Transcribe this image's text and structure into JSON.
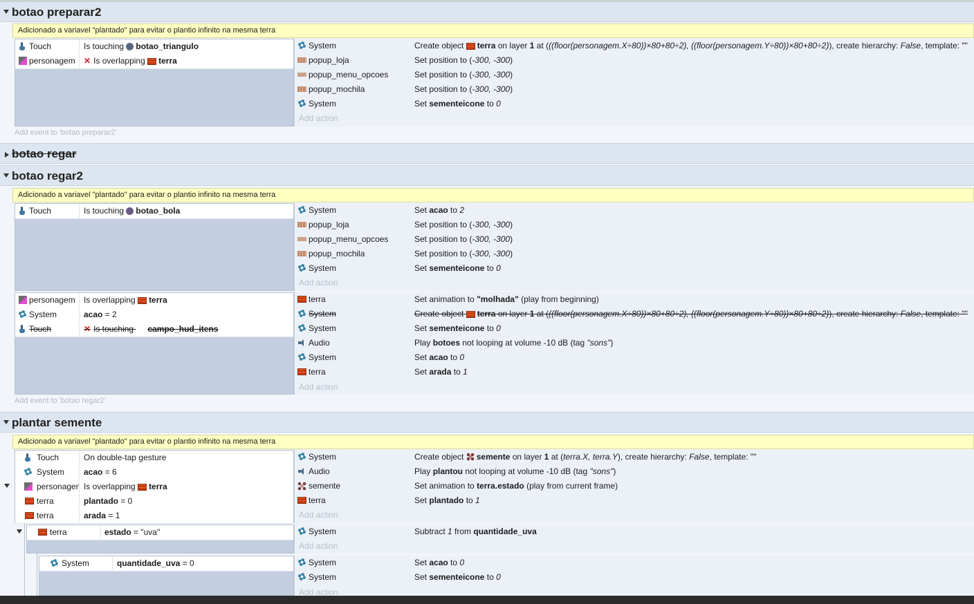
{
  "comment": "Adicionado a variavel \"plantado\" para evitar o plantio infinito na mesma terra",
  "add_action": "Add action",
  "groups": {
    "preparar2": {
      "title": "botao preparar2",
      "add_event": "Add event to 'botao preparar2'",
      "conditions": [
        {
          "obj": "Touch",
          "cond_pre": "Is touching",
          "cond_b": "botao_triangulo"
        },
        {
          "obj": "personagem",
          "cond_pre": "Is overlapping",
          "cond_b": "terra"
        }
      ],
      "actions": [
        {
          "obj": "System",
          "pre": "Create object ",
          "b1": "terra",
          "mid": " on layer ",
          "b2": "1",
          "post": " at (",
          "i1": "((floor(personagem.X÷80))×80+80÷2), ((floor(personagem.Y÷80))×80+80÷2)",
          "post2": "), create hierarchy: ",
          "i2": "False",
          "post3": ", template: \"\""
        },
        {
          "obj": "popup_loja",
          "pre": "Set position to (",
          "i1": "-300, -300",
          "post": ")"
        },
        {
          "obj": "popup_menu_opcoes",
          "pre": "Set position to (",
          "i1": "-300, -300",
          "post": ")"
        },
        {
          "obj": "popup_mochila",
          "pre": "Set position to (",
          "i1": "-300, -300",
          "post": ")"
        },
        {
          "obj": "System",
          "pre": "Set ",
          "b1": "sementeicone",
          "mid": " to ",
          "i1": "0"
        }
      ]
    },
    "regar": {
      "title": "botao regar"
    },
    "regar2": {
      "title": "botao regar2",
      "add_event": "Add event to 'botao regar2'",
      "ev1_conditions": [
        {
          "obj": "Touch",
          "cond_pre": "Is touching",
          "cond_b": "botao_bola"
        }
      ],
      "ev1_actions": [
        {
          "obj": "System",
          "pre": "Set ",
          "b1": "acao",
          "mid": " to ",
          "i1": "2"
        },
        {
          "obj": "popup_loja",
          "pre": "Set position to (",
          "i1": "-300, -300",
          "post": ")"
        },
        {
          "obj": "popup_menu_opcoes",
          "pre": "Set position to (",
          "i1": "-300, -300",
          "post": ")"
        },
        {
          "obj": "popup_mochila",
          "pre": "Set position to (",
          "i1": "-300, -300",
          "post": ")"
        },
        {
          "obj": "System",
          "pre": "Set ",
          "b1": "sementeicone",
          "mid": " to ",
          "i1": "0"
        }
      ],
      "ev2_conditions": [
        {
          "obj": "personagem",
          "cond_pre": "Is overlapping",
          "cond_b": "terra"
        },
        {
          "obj": "System",
          "cond_b": "acao",
          "cond_post": " = 2"
        },
        {
          "obj": "Touch",
          "cond_pre": "Is touching",
          "cond_b": "campo_hud_itens"
        }
      ],
      "ev2_actions": [
        {
          "obj": "terra",
          "pre": "Set animation to ",
          "b1": "\"molhada\"",
          "post": " (play from beginning)"
        },
        {
          "obj": "System",
          "pre": "Create object ",
          "b1": "terra",
          "mid": " on layer ",
          "b2": "1",
          "post": " at (",
          "i1": "((floor(personagem.X÷80))×80+80÷2), ((floor(personagem.Y÷80))×80+80÷2)",
          "post2": "), create hierarchy: ",
          "i2": "False",
          "post3": ", template: \"\""
        },
        {
          "obj": "System",
          "pre": "Set ",
          "b1": "sementeicone",
          "mid": " to ",
          "i1": "0"
        },
        {
          "obj": "Audio",
          "pre": "Play ",
          "b1": "botoes",
          "mid": " not looping at volume -10 dB (tag ",
          "i1": "\"sons\"",
          "post": ")"
        },
        {
          "obj": "System",
          "pre": "Set ",
          "b1": "acao",
          "mid": " to ",
          "i1": "0"
        },
        {
          "obj": "terra",
          "pre": "Set ",
          "b1": "arada",
          "mid": " to ",
          "i1": "1"
        }
      ]
    },
    "plantar": {
      "title": "plantar semente",
      "conditions": [
        {
          "obj": "Touch",
          "cond_pre": "On double-tap gesture"
        },
        {
          "obj": "System",
          "cond_b": "acao",
          "cond_post": " = 6"
        },
        {
          "obj": "personagem",
          "cond_pre": "Is overlapping",
          "cond_b": "terra"
        },
        {
          "obj": "terra",
          "cond_b": "plantado",
          "cond_post": " = 0"
        },
        {
          "obj": "terra",
          "cond_b": "arada",
          "cond_post": " = 1"
        }
      ],
      "actions": [
        {
          "obj": "System",
          "pre": "Create object ",
          "b1": "semente",
          "mid": " on layer ",
          "b2": "1",
          "post": " at (",
          "i1": "terra.X, terra.Y",
          "post2": "), create hierarchy: ",
          "i2": "False",
          "post3": ", template: \"\""
        },
        {
          "obj": "Audio",
          "pre": "Play ",
          "b1": "plantou",
          "mid": " not looping at volume -10 dB (tag ",
          "i1": "\"sons\"",
          "post": ")"
        },
        {
          "obj": "semente",
          "pre": "Set animation to ",
          "b1": "terra.estado",
          "post": " (play from current frame)"
        },
        {
          "obj": "terra",
          "pre": "Set ",
          "b1": "plantado",
          "mid": " to ",
          "i1": "1"
        }
      ],
      "sub1_condition": {
        "obj": "terra",
        "cond_b": "estado",
        "cond_post": " = \"uva\""
      },
      "sub1_actions": [
        {
          "obj": "System",
          "pre": "Subtract ",
          "i1": "1",
          "mid": " from ",
          "b1": "quantidade_uva"
        }
      ],
      "sub2_condition": {
        "obj": "System",
        "cond_b": "quantidade_uva",
        "cond_post": " = 0"
      },
      "sub2_actions": [
        {
          "obj": "System",
          "pre": "Set ",
          "b1": "acao",
          "mid": " to ",
          "i1": "0"
        },
        {
          "obj": "System",
          "pre": "Set ",
          "b1": "sementeicone",
          "mid": " to ",
          "i1": "0"
        }
      ]
    }
  }
}
